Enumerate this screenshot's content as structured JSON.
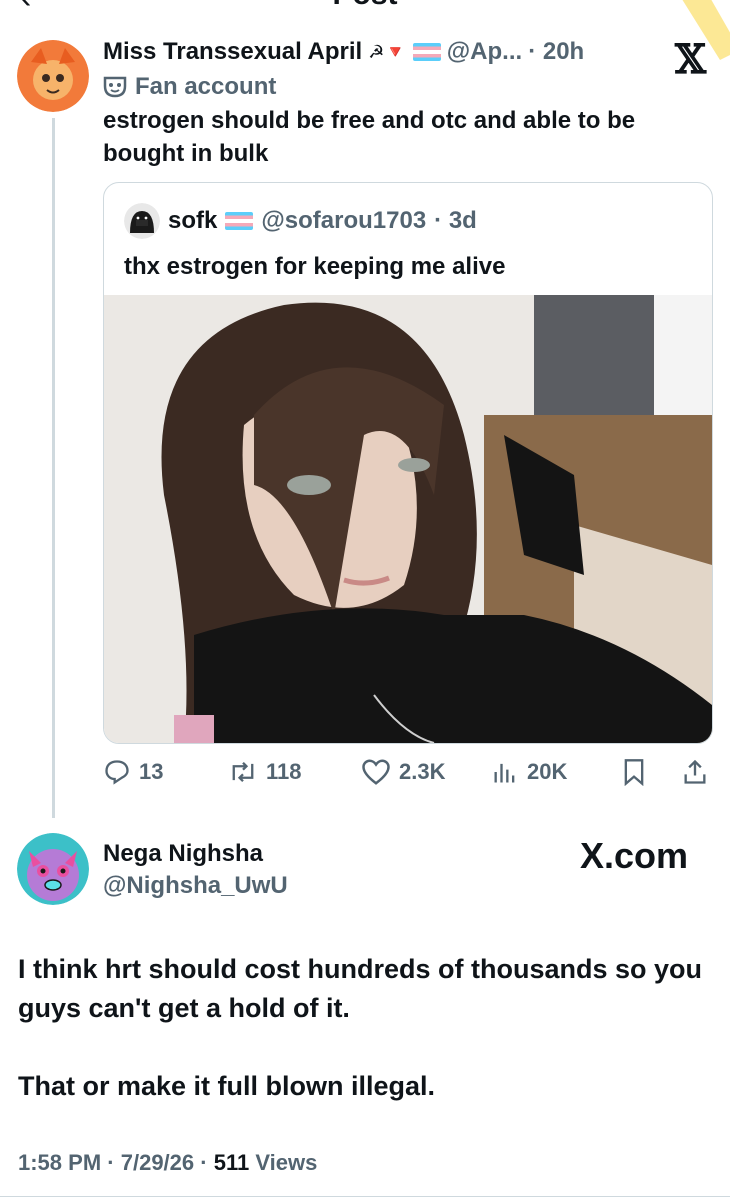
{
  "topbar": {
    "title": "Post",
    "back_icon": "chevron-left-icon"
  },
  "main_tweet": {
    "display_name": "Miss Transsexual April",
    "name_emojis": "☭🔻",
    "handle": "@Ap...",
    "time": "· 20h",
    "label": "Fan account",
    "text": "estrogen should be free and otc and able to be bought in bulk"
  },
  "quote": {
    "display_name": "sofk",
    "handle": "@sofarou1703",
    "time": "· 3d",
    "text": "thx estrogen for keeping me alive"
  },
  "actions": {
    "replies": "13",
    "reposts": "118",
    "likes": "2.3K",
    "views": "20K"
  },
  "reply": {
    "display_name": "Nega Nighsha",
    "handle": "@Nighsha_UwU",
    "watermark": "X.com",
    "line1": "I think hrt should cost hundreds of thousands so you guys can't get a hold of it.",
    "line2": "That or make it full blown illegal.",
    "time": "1:58 PM",
    "date": "7/29/26",
    "views_count": "511",
    "views_label": "Views"
  },
  "colors": {
    "text": "#0f1419",
    "muted": "#536471",
    "border": "#cfd9de",
    "trans_blue": "#5bcefa",
    "trans_pink": "#f5a9b8"
  }
}
